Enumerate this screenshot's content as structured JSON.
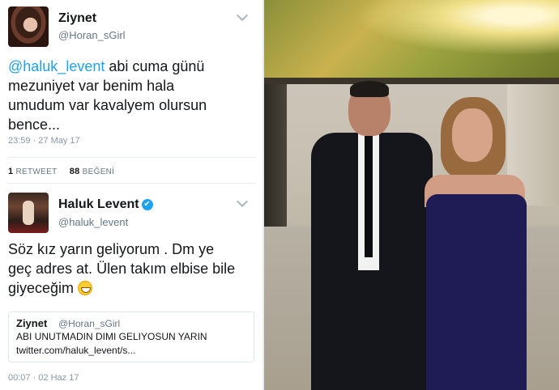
{
  "tweet1": {
    "name": "Ziynet",
    "handle": "@Horan_sGirl",
    "mention": "@haluk_levent",
    "text_line1": " abi cuma günü",
    "text_line2": "mezuniyet var benim hala",
    "text_line3": "umudum var kavalyem olursun",
    "text_line4": "bence...",
    "timestamp": "23:59 · 27 May 17",
    "retweets_count": "1",
    "retweets_label": "RETWEET",
    "likes_count": "88",
    "likes_label": "BEĞENİ"
  },
  "tweet2": {
    "name": "Haluk Levent",
    "verified_glyph": "✔",
    "handle": "@haluk_levent",
    "text_line1": "Söz kız yarın geliyorum . Dm ye",
    "text_line2": "geç adres at. Ülen takım elbise bile",
    "text_line3": "giyeceğim",
    "emoji_name": "grinning-face",
    "timestamp": "00:07 · 02 Haz 17",
    "quote": {
      "name": "Ziynet",
      "handle": "@Horan_sGirl",
      "text": "ABI UNUTMADIN DIMI GELIYOSUN YARIN",
      "link": "twitter.com/haluk_levent/s..."
    }
  },
  "icons": {
    "menu": "chevron-down-icon",
    "verified": "verified-badge-icon"
  },
  "colors": {
    "mention": "#1da1f2",
    "meta": "#8899a6",
    "divider": "#e6ecf0"
  }
}
